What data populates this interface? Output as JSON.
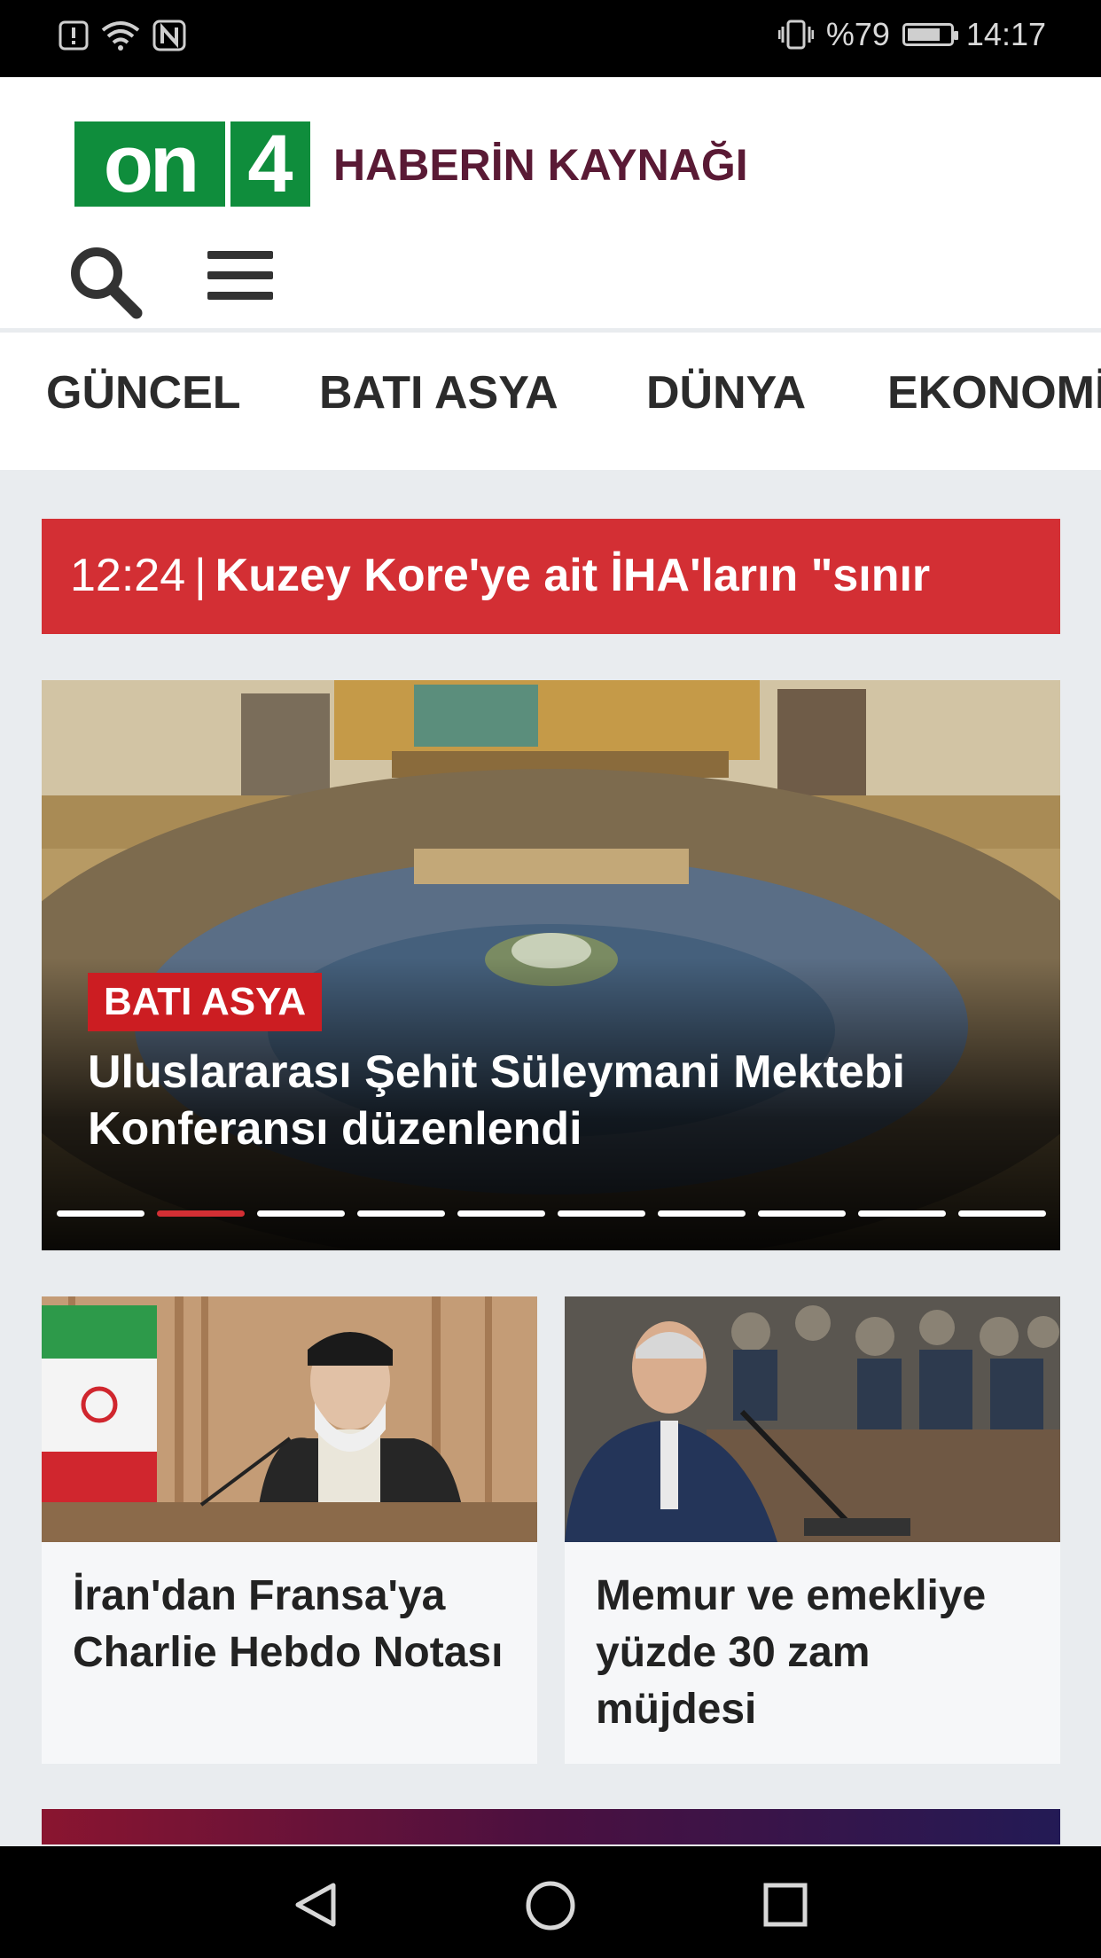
{
  "status_bar": {
    "battery": "%79",
    "battery_level": 0.79,
    "time": "14:17",
    "icons": [
      "alert-icon",
      "wifi-icon",
      "nfc-icon",
      "vibrate-icon",
      "battery-icon"
    ]
  },
  "header": {
    "logo_on": "on",
    "logo_four": "4",
    "slogan": "HABERİN KAYNAĞI",
    "icons": [
      "search-icon",
      "menu-icon"
    ]
  },
  "categories": [
    "GÜNCEL",
    "BATI ASYA",
    "DÜNYA",
    "EKONOMİ"
  ],
  "ticker": {
    "time": "12:24",
    "separator": "|",
    "headline": "Kuzey Kore'ye ait İHA'ların \"sınır"
  },
  "slider": {
    "category": "BATI ASYA",
    "title": "Uluslararası Şehit Süleymani Mektebi Konferansı düzenlendi",
    "dot_count": 10,
    "active_index": 1
  },
  "cards": [
    {
      "title": "İran'dan Fransa'ya Charlie Hebdo Notası"
    },
    {
      "title": "Memur ve emekliye yüzde 30 zam müjdesi"
    }
  ],
  "colors": {
    "brand_green": "#0f8d3c",
    "slogan": "#5a1a35",
    "accent_red": "#d32f34",
    "badge_red": "#cc1d22"
  },
  "navigation": [
    "back-icon",
    "home-icon",
    "recent-apps-icon"
  ]
}
